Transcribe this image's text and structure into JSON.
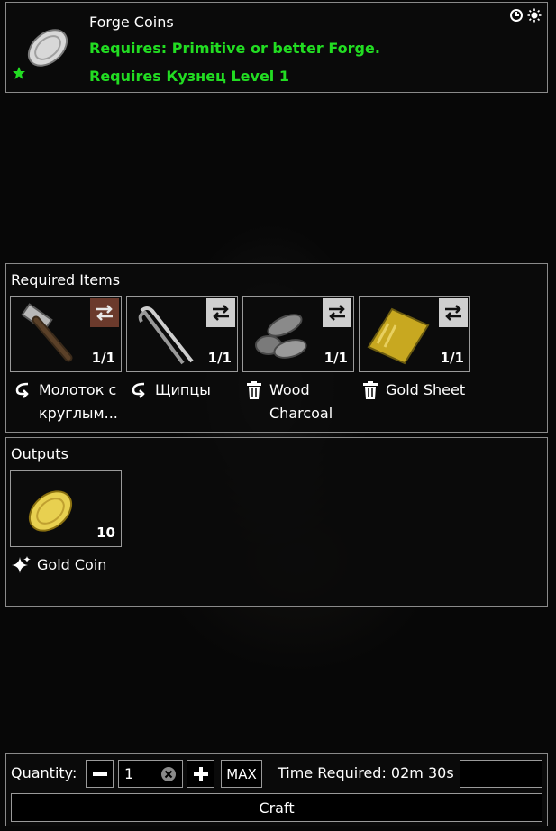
{
  "header": {
    "title": "Forge Coins",
    "requirement_station": "Requires: Primitive or better Forge.",
    "requirement_skill": "Requires Кузнец Level 1",
    "icons": [
      "clock-icon",
      "sun-icon"
    ],
    "item_icon": "silver-coin-icon",
    "favorite_icon": "star-icon"
  },
  "required_items": {
    "title": "Required Items",
    "items": [
      {
        "name": "Молоток с круглым...",
        "name_line1": "Молоток с",
        "name_line2": "круглым...",
        "quantity": "1/1",
        "icon": "hammer-icon",
        "action_icon": "return-arrow-icon",
        "swap_style": "brown"
      },
      {
        "name": "Щипцы",
        "name_line1": "Щипцы",
        "name_line2": "",
        "quantity": "1/1",
        "icon": "tongs-icon",
        "action_icon": "return-arrow-icon",
        "swap_style": "gray"
      },
      {
        "name": "Wood Charcoal",
        "name_line1": "Wood",
        "name_line2": "Charcoal",
        "quantity": "1/1",
        "icon": "charcoal-icon",
        "action_icon": "trash-icon",
        "swap_style": "gray"
      },
      {
        "name": "Gold Sheet",
        "name_line1": "Gold Sheet",
        "name_line2": "",
        "quantity": "1/1",
        "icon": "gold-sheet-icon",
        "action_icon": "trash-icon",
        "swap_style": "gray"
      }
    ]
  },
  "outputs": {
    "title": "Outputs",
    "items": [
      {
        "name": "Gold Coin",
        "quantity": "10",
        "icon": "gold-coin-icon",
        "action_icon": "sparkle-icon"
      }
    ]
  },
  "bottom": {
    "quantity_label": "Quantity:",
    "quantity_value": "1",
    "max_label": "MAX",
    "time_label": "Time Required: 02m 30s",
    "craft_label": "Craft"
  },
  "colors": {
    "requirement_text": "#22dd22",
    "border": "#8a8a8a",
    "swap_brown": "#6b3a2c",
    "swap_gray": "#cfcfcf"
  }
}
